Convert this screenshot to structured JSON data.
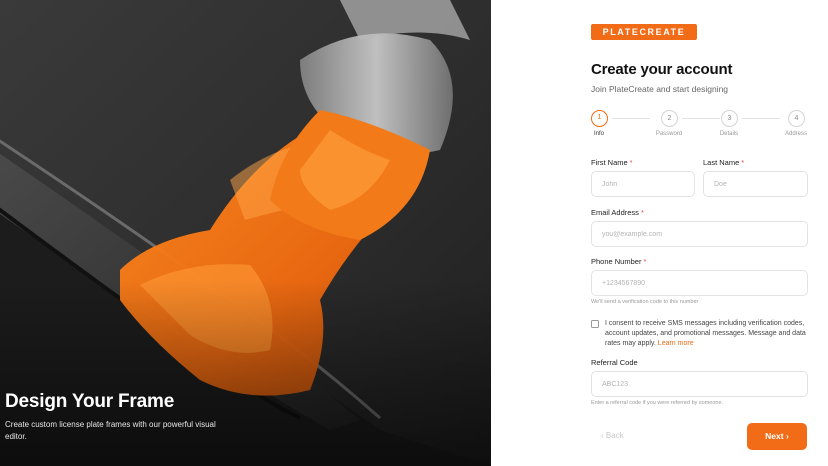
{
  "hero": {
    "title": "Design Your Frame",
    "subtitle": "Create custom license plate frames with our powerful visual editor."
  },
  "brand": {
    "logo_text": "PLATECREATE",
    "accent_color": "#f26b16"
  },
  "form": {
    "title": "Create your account",
    "subtitle": "Join PlateCreate and start designing",
    "steps": [
      {
        "number": "1",
        "label": "Info",
        "active": true
      },
      {
        "number": "2",
        "label": "Password",
        "active": false
      },
      {
        "number": "3",
        "label": "Details",
        "active": false
      },
      {
        "number": "4",
        "label": "Address",
        "active": false
      }
    ],
    "first_name": {
      "label": "First Name",
      "required": "*",
      "placeholder": "John",
      "value": ""
    },
    "last_name": {
      "label": "Last Name",
      "required": "*",
      "placeholder": "Doe",
      "value": ""
    },
    "email": {
      "label": "Email Address",
      "required": "*",
      "placeholder": "you@example.com",
      "value": ""
    },
    "phone": {
      "label": "Phone Number",
      "required": "*",
      "placeholder": "+1234567890",
      "value": "",
      "hint": "We'll send a verification code to this number"
    },
    "consent": {
      "text": "I consent to receive SMS messages including verification codes, account updates, and promotional messages. Message and data rates may apply.",
      "link": "Learn more",
      "checked": false
    },
    "referral": {
      "label": "Referral Code",
      "placeholder": "ABC123",
      "value": "",
      "hint": "Enter a referral code if you were referred by someone."
    },
    "back_label": "Back",
    "back_icon": "chevron-left-icon",
    "next_label": "Next",
    "next_icon": "chevron-right-icon"
  }
}
